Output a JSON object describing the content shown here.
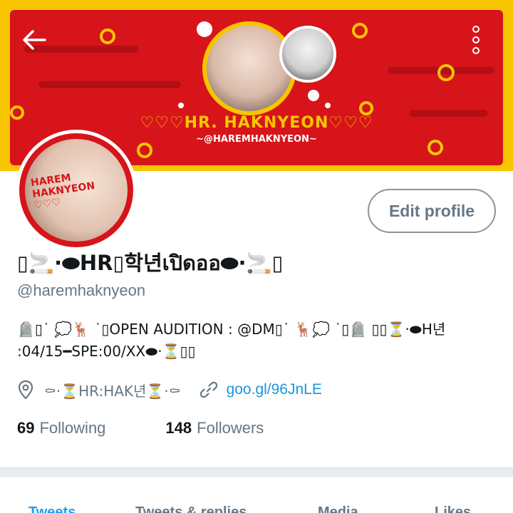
{
  "profile": {
    "display_name": "▯🚬·⬬HR▯학년เปิดออ⬬·🚬▯",
    "handle": "@haremhaknyeon",
    "bio_line1": "🪦▯˙ 💭🦌 ˙▯OPEN AUDITION : @DM▯˙ 🦌💭 ˙▯🪦 ▯▯⏳·⬬H년",
    "bio_line2": ":04/15━SPE:00/XX⬬·⏳▯▯",
    "location": "⚰·⏳HR:HAK년⏳·⚰",
    "link": "goo.gl/96JnLE",
    "following_count": "69",
    "following_label": "Following",
    "followers_count": "148",
    "followers_label": "Followers"
  },
  "banner": {
    "title": "♡♡♡HR. HAKNYEON♡♡♡",
    "handle": "~@HAREMHAKNYEON~"
  },
  "avatar": {
    "text_line1": "HAREM",
    "text_line2": "HAKNYEON",
    "text_line3": "♡♡♡"
  },
  "buttons": {
    "edit_profile": "Edit profile"
  },
  "tabs": [
    {
      "label": "Tweets",
      "active": true
    },
    {
      "label": "Tweets & replies",
      "active": false
    },
    {
      "label": "Media",
      "active": false
    },
    {
      "label": "Likes",
      "active": false
    }
  ],
  "colors": {
    "accent": "#1da1f2",
    "link": "#1b95e0",
    "banner_red": "#d7141a",
    "banner_yellow": "#f7c600",
    "secondary_text": "#657786"
  },
  "icons": {
    "back": "arrow-left-icon",
    "more": "more-vertical-icon",
    "location": "location-pin-icon",
    "link": "link-icon"
  }
}
